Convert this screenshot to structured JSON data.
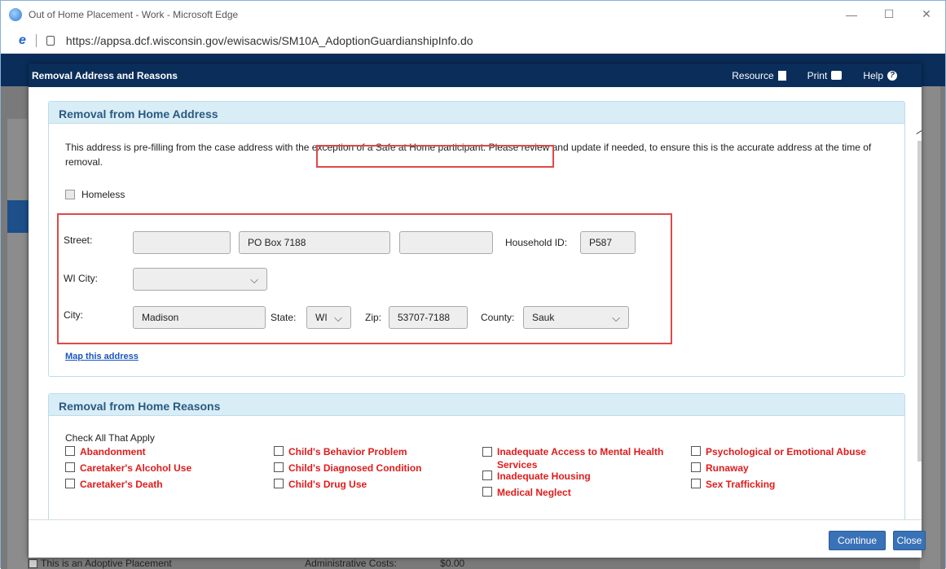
{
  "browser": {
    "title": "Out of Home Placement - Work - Microsoft Edge",
    "url": "https://appsa.dcf.wisconsin.gov/ewisacwis/SM10A_AdoptionGuardianshipInfo.do",
    "minimize": "—",
    "maximize": "☐",
    "close": "✕"
  },
  "dialog": {
    "title": "Removal Address and Reasons",
    "links": {
      "resource": "Resource",
      "print": "Print",
      "help": "Help"
    }
  },
  "address_section": {
    "header": "Removal from Home Address",
    "info_text": "This address is pre-filling from the case address with the exception of a Safe at Home participant. Please review and update if needed, to ensure this is the accurate address at the time of removal.",
    "homeless_label": "Homeless",
    "street_label": "Street:",
    "street_1": "",
    "street_2": "PO Box 7188",
    "street_3": "",
    "household_label": "Household ID:",
    "household_id": "P587",
    "wi_city_label": "WI City:",
    "wi_city_value": "",
    "city_label": "City:",
    "city_value": "Madison",
    "state_label": "State:",
    "state_value": "WI",
    "zip_label": "Zip:",
    "zip_value": "53707-7188",
    "county_label": "County:",
    "county_value": "Sauk",
    "map_link": "Map this address"
  },
  "reasons_section": {
    "header": "Removal from Home Reasons",
    "check_all": "Check All That Apply",
    "columns": [
      [
        "Abandonment",
        "Caretaker's Alcohol Use",
        "Caretaker's Death"
      ],
      [
        "Child's Behavior Problem",
        "Child's Diagnosed Condition",
        "Child's Drug Use"
      ],
      [
        "Inadequate Access to Mental Health Services",
        "Inadequate Housing",
        "Medical Neglect"
      ],
      [
        "Psychological or Emotional Abuse",
        "Runaway",
        "Sex Trafficking"
      ]
    ]
  },
  "footer": {
    "continue": "Continue",
    "close": "Close"
  },
  "background": {
    "adoptive": "This is an Adoptive Placement",
    "admin_costs": "Administrative Costs:",
    "admin_value": "$0.00"
  },
  "colors": {
    "header_navy": "#0a2d5a",
    "required_red": "#e01b1b",
    "panel_header": "#d9edf7",
    "button_blue": "#3a72b8",
    "highlight": "#e04848"
  }
}
